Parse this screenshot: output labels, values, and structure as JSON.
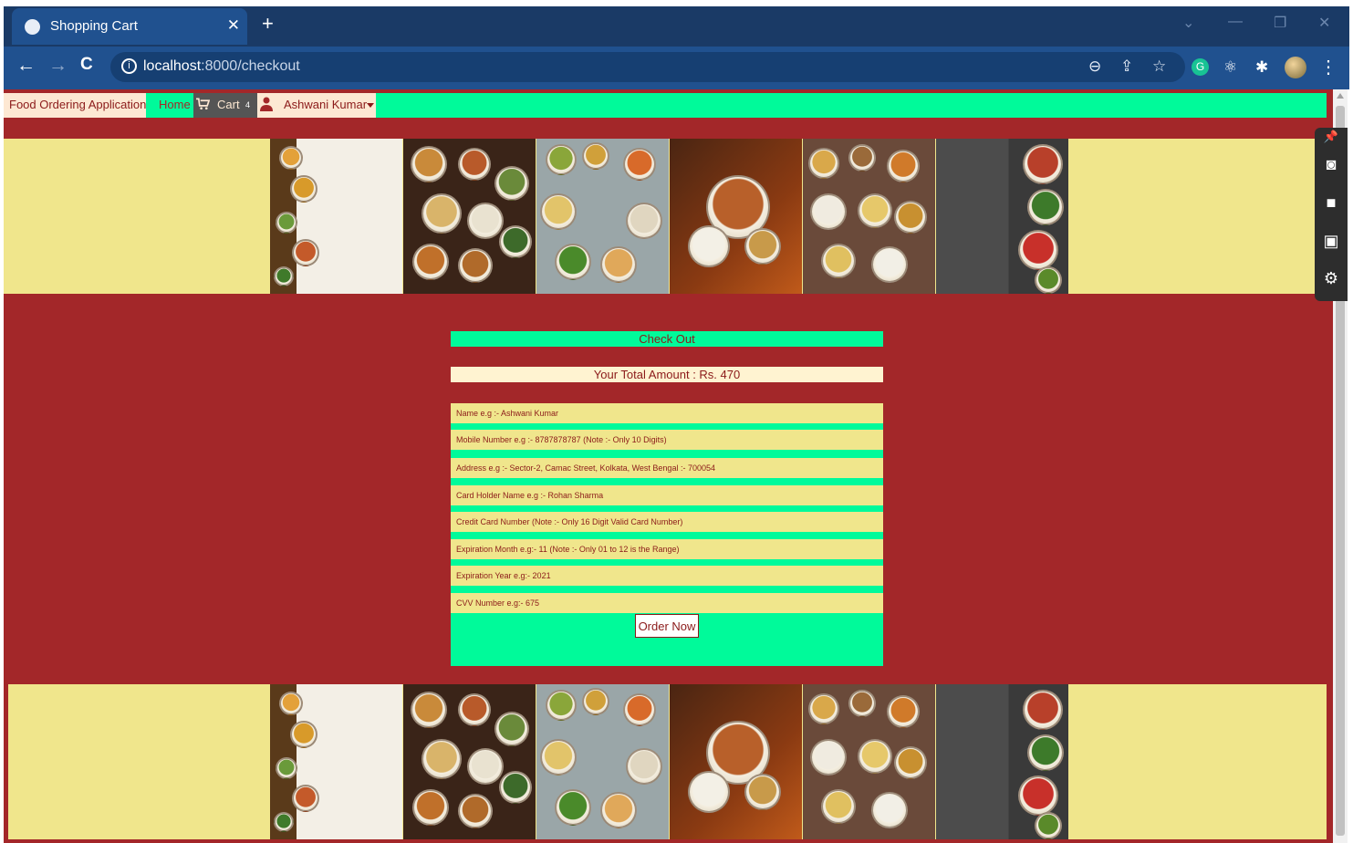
{
  "browser": {
    "tab_title": "Shopping Cart",
    "tab_close": "✕",
    "new_tab": "+",
    "url_host": "localhost",
    "url_rest": ":8000/checkout",
    "nav_back": "←",
    "nav_forward": "→",
    "nav_reload": "C",
    "window_min": "—",
    "window_restore": "❐",
    "window_close": "✕",
    "window_down": "⌄"
  },
  "navbar": {
    "brand": "Food Ordering Application",
    "home": "Home",
    "cart": "Cart",
    "cart_count": "4",
    "user": "Ashwani Kumar"
  },
  "checkout": {
    "heading": "Check Out",
    "total": "Your Total Amount : Rs. 470",
    "fields": [
      {
        "placeholder": "Name e.g :- Ashwani Kumar"
      },
      {
        "placeholder": "Mobile Number e.g :- 8787878787 (Note :- Only 10 Digits)"
      },
      {
        "placeholder": "Address e.g :- Sector-2, Camac Street, Kolkata, West Bengal :- 700054"
      },
      {
        "placeholder": "Card Holder Name e.g :- Rohan Sharma"
      },
      {
        "placeholder": "Credit Card Number (Note :- Only 16 Digit Valid Card Number)"
      },
      {
        "placeholder": "Expiration Month e.g:- 11 (Note :- Only 01 to 12 is the Range)"
      },
      {
        "placeholder": "Expiration Year e.g:- 2021"
      },
      {
        "placeholder": "CVV Number e.g:- 675"
      }
    ],
    "button": "Order Now"
  },
  "colors": {
    "page_bg": "#a32729",
    "accent_green": "#00fa9a",
    "khaki": "#f0e68c",
    "text_maroon": "#8b1a1a"
  }
}
